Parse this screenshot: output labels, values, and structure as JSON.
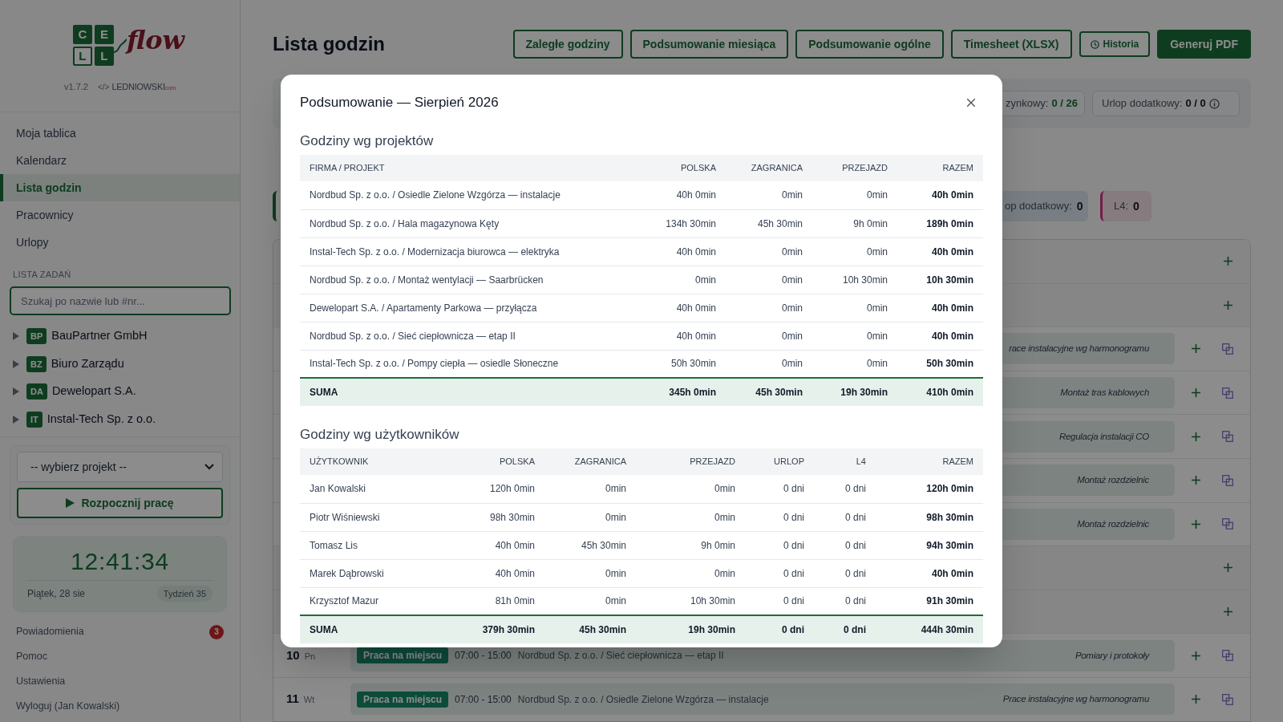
{
  "sidebar": {
    "logo": {
      "letters": [
        "C",
        "E",
        "L",
        "L"
      ],
      "script": "flow"
    },
    "version": "v1.7.2",
    "credit": {
      "mark": "</>",
      "name": "LEDNIOWSKI",
      "suffix": "com"
    },
    "nav": [
      {
        "label": "Moja tablica",
        "selected": false
      },
      {
        "label": "Kalendarz",
        "selected": false
      },
      {
        "label": "Lista godzin",
        "selected": true
      },
      {
        "label": "Pracownicy",
        "selected": false
      },
      {
        "label": "Urlopy",
        "selected": false
      }
    ],
    "tasks_heading": "LISTA ZADAŃ",
    "search": {
      "placeholder": "Szukaj po nazwie lub #nr..."
    },
    "clients": [
      {
        "initials": "BP",
        "name": "BauPartner GmbH",
        "expanded": false
      },
      {
        "initials": "BZ",
        "name": "Biuro Zarządu",
        "expanded": false
      },
      {
        "initials": "DA",
        "name": "Dewelopart S.A.",
        "expanded": false
      },
      {
        "initials": "IT",
        "name": "Instal-Tech Sp. z o.o.",
        "expanded": false
      }
    ],
    "project_select": {
      "value": "-- wybierz projekt --"
    },
    "start_button": "Rozpocznij pracę",
    "clock": {
      "time": "12:41:34",
      "date": "Piątek, 28 sie",
      "week": "Tydzień 35"
    },
    "footer_links": [
      {
        "label": "Powiadomienia",
        "badge": "3"
      },
      {
        "label": "Pomoc"
      },
      {
        "label": "Ustawienia"
      },
      {
        "label": "Wyloguj (Jan Kowalski)"
      }
    ]
  },
  "page": {
    "title": "Lista godzin",
    "actions": [
      {
        "label": "Zaległe godziny",
        "kind": "outline"
      },
      {
        "label": "Podsumowanie miesiąca",
        "kind": "outline"
      },
      {
        "label": "Podsumowanie ogólne",
        "kind": "outline"
      },
      {
        "label": "Timesheet (XLSX)",
        "kind": "outline"
      },
      {
        "label": "Historia",
        "kind": "small"
      },
      {
        "label": "Generuj PDF",
        "kind": "primary"
      }
    ],
    "balance_chips": [
      {
        "label": "zynkowy:",
        "value": "0 / 26",
        "kind": "accent",
        "info": false
      },
      {
        "label": "Urlop dodatkowy:",
        "value": "0 / 0",
        "kind": "plain",
        "info": true
      }
    ],
    "count_chips": [
      {
        "kind": "green"
      },
      {
        "label": "op dodatkowy:",
        "value": "0",
        "kind": "blue"
      },
      {
        "label": "L4:",
        "value": "0",
        "kind": "pink"
      }
    ],
    "days": [
      {
        "kind": "empty"
      },
      {
        "kind": "empty"
      },
      {
        "kind": "entry",
        "note": "race instalacyjne wg harmonogramu"
      },
      {
        "kind": "entry",
        "note": "Montaż tras kablowych"
      },
      {
        "kind": "entry",
        "note": "Regulacja instalacji CO"
      },
      {
        "kind": "entry",
        "note": "Montaż rozdzielnic"
      },
      {
        "kind": "entry",
        "note": "Montaż rozdzielnic"
      },
      {
        "kind": "empty"
      },
      {
        "kind": "empty"
      },
      {
        "kind": "entry",
        "day": "10",
        "weekday": "Pn",
        "badge": "Praca na miejscu",
        "time": "07:00 - 15:00",
        "project": "Nordbud Sp. z o.o. / Sieć ciepłownicza — etap II",
        "note": "Pomiary i protokoły"
      },
      {
        "kind": "entry",
        "day": "11",
        "weekday": "Wt",
        "badge": "Praca na miejscu",
        "time": "07:00 - 15:00",
        "project": "Nordbud Sp. z o.o. / Osiedle Zielone Wzgórza — instalacje",
        "note": "Prace instalacyjne wg harmonogramu"
      }
    ]
  },
  "modal": {
    "title": "Podsumowanie — Sierpień 2026",
    "sections": [
      {
        "heading": "Godziny wg projektów",
        "columns": [
          "FIRMA / PROJEKT",
          "POLSKA",
          "ZAGRANICA",
          "PRZEJAZD",
          "RAZEM"
        ],
        "rows": [
          [
            "Nordbud Sp. z o.o. / Osiedle Zielone Wzgórza — instalacje",
            "40h 0min",
            "0min",
            "0min",
            "40h 0min"
          ],
          [
            "Nordbud Sp. z o.o. / Hala magazynowa Kęty",
            "134h 30min",
            "45h 30min",
            "9h 0min",
            "189h 0min"
          ],
          [
            "Instal-Tech Sp. z o.o. / Modernizacja biurowca — elektryka",
            "40h 0min",
            "0min",
            "0min",
            "40h 0min"
          ],
          [
            "Nordbud Sp. z o.o. / Montaż wentylacji — Saarbrücken",
            "0min",
            "0min",
            "10h 30min",
            "10h 30min"
          ],
          [
            "Dewelopart S.A. / Apartamenty Parkowa — przyłącza",
            "40h 0min",
            "0min",
            "0min",
            "40h 0min"
          ],
          [
            "Nordbud Sp. z o.o. / Sieć ciepłownicza — etap II",
            "40h 0min",
            "0min",
            "0min",
            "40h 0min"
          ],
          [
            "Instal-Tech Sp. z o.o. / Pompy ciepła — osiedle Słoneczne",
            "50h 30min",
            "0min",
            "0min",
            "50h 30min"
          ]
        ],
        "total": [
          "SUMA",
          "345h 0min",
          "45h 30min",
          "19h 30min",
          "410h 0min"
        ]
      },
      {
        "heading": "Godziny wg użytkowników",
        "columns": [
          "UŻYTKOWNIK",
          "POLSKA",
          "ZAGRANICA",
          "PRZEJAZD",
          "URLOP",
          "L4",
          "RAZEM"
        ],
        "rows": [
          [
            "Jan Kowalski",
            "120h 0min",
            "0min",
            "0min",
            "0 dni",
            "0 dni",
            "120h 0min"
          ],
          [
            "Piotr Wiśniewski",
            "98h 30min",
            "0min",
            "0min",
            "0 dni",
            "0 dni",
            "98h 30min"
          ],
          [
            "Tomasz Lis",
            "40h 0min",
            "45h 30min",
            "9h 0min",
            "0 dni",
            "0 dni",
            "94h 30min"
          ],
          [
            "Marek Dąbrowski",
            "40h 0min",
            "0min",
            "0min",
            "0 dni",
            "0 dni",
            "40h 0min"
          ],
          [
            "Krzysztof Mazur",
            "81h 0min",
            "0min",
            "10h 30min",
            "0 dni",
            "0 dni",
            "91h 30min"
          ]
        ],
        "total": [
          "SUMA",
          "379h 30min",
          "45h 30min",
          "19h 30min",
          "0 dni",
          "0 dni",
          "444h 30min"
        ]
      }
    ]
  }
}
